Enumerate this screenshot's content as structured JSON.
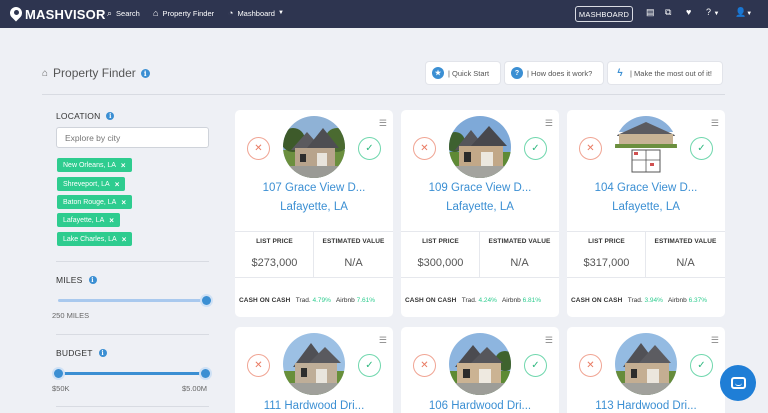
{
  "brand": {
    "name": "MASHVISOR",
    "accent": "#3b8fd3",
    "nav_bg": "#2e3550",
    "chip_color": "#2ecc8f"
  },
  "nav": {
    "search": "Search",
    "property_finder": "Property Finder",
    "mashboard_menu": "Mashboard",
    "mashboard_button": "MASHBOARD",
    "icons": [
      "calculator-icon",
      "compare-icon",
      "heart-icon",
      "help-icon",
      "user-icon"
    ]
  },
  "header": {
    "title": "Property Finder",
    "quick_start": "| Quick Start",
    "how_it_works": "| How does it work?",
    "most_out": "| Make the most out of it!"
  },
  "sidebar": {
    "location_label": "LOCATION",
    "city_placeholder": "Explore by city",
    "cities": [
      "New Orleans, LA",
      "Shreveport, LA",
      "Baton Rouge, LA",
      "Lafayette, LA",
      "Lake Charles, LA"
    ],
    "miles_label": "MILES",
    "miles_value": "250 MILES",
    "miles_slider_fraction": 1.0,
    "budget_label": "BUDGET",
    "budget_min": "$50K",
    "budget_max": "$5.00M"
  },
  "card_labels": {
    "list_price": "LIST PRICE",
    "estimated_value": "ESTIMATED VALUE",
    "cash_on_cash": "CASH ON CASH",
    "trad": "Trad.",
    "airbnb": "Airbnb"
  },
  "properties": [
    {
      "address": "107 Grace View D...",
      "city": "Lafayette, LA",
      "list_price": "$273,000",
      "estimated_value": "N/A",
      "trad": "4.79%",
      "airbnb": "7.61%"
    },
    {
      "address": "109 Grace View D...",
      "city": "Lafayette, LA",
      "list_price": "$300,000",
      "estimated_value": "N/A",
      "trad": "4.24%",
      "airbnb": "6.81%"
    },
    {
      "address": "104 Grace View D...",
      "city": "Lafayette, LA",
      "list_price": "$317,000",
      "estimated_value": "N/A",
      "trad": "3.94%",
      "airbnb": "6.37%"
    },
    {
      "address": "111 Hardwood Dri..."
    },
    {
      "address": "106 Hardwood Dri..."
    },
    {
      "address": "113 Hardwood Dri..."
    }
  ]
}
